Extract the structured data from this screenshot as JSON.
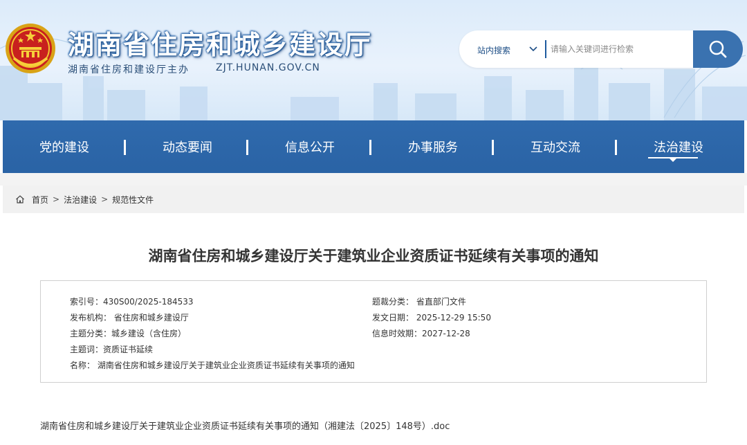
{
  "header": {
    "title": "湖南省住房和城乡建设厅",
    "sponsor": "湖南省住房和建设厅主办",
    "domain": "ZJT.HUNAN.GOV.CN",
    "emblem_icon": "national-emblem-icon"
  },
  "search": {
    "scope_label": "站内搜索",
    "placeholder": "请输入关键词进行检索",
    "button_icon": "search-icon"
  },
  "nav": {
    "items": [
      {
        "label": "党的建设"
      },
      {
        "label": "动态要闻"
      },
      {
        "label": "信息公开"
      },
      {
        "label": "办事服务"
      },
      {
        "label": "互动交流"
      },
      {
        "label": "法治建设"
      }
    ],
    "active": "法治建设"
  },
  "breadcrumb": {
    "home": "首页",
    "items": [
      "法治建设",
      "规范性文件"
    ],
    "separator": ">"
  },
  "document": {
    "title": "湖南省住房和城乡建设厅关于建筑业企业资质证书延续有关事项的通知",
    "meta": {
      "index_no": "索引号：430S00/2025-184533",
      "category": "题裁分类：  省直部门文件",
      "publisher": "发布机构：  省住房和城乡建设厅",
      "publish_date": "发文日期：  2025-12-29 15:50",
      "topic": "主题分类：城乡建设（含住房）",
      "valid_until": "信息时效期：2027-12-28",
      "keywords": "主题词：资质证书延续",
      "name": "名称：  湖南省住房和城乡建设厅关于建筑业企业资质证书延续有关事项的通知"
    },
    "attachment": "湖南省住房和城乡建设厅关于建筑业企业资质证书延续有关事项的通知（湘建法〔2025〕148号）.doc"
  },
  "colors": {
    "nav_bg": "#2d67a9",
    "title_text": "#ffffff",
    "search_button": "#3a72b0"
  }
}
